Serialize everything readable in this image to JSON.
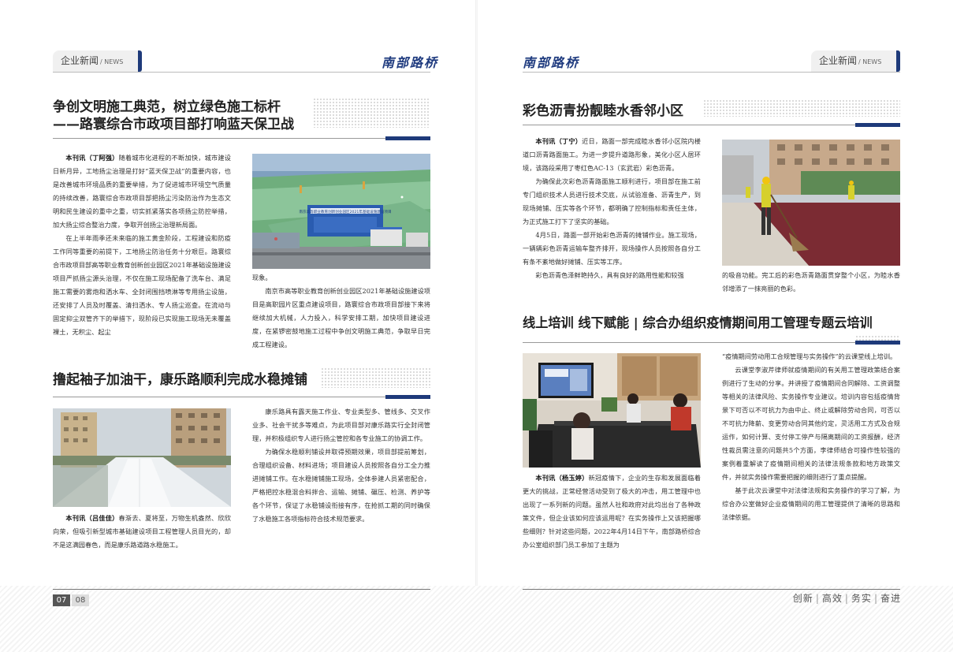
{
  "left_page": {
    "section_tab": "企业新闻",
    "section_tab_en": "/ NEWS",
    "brand": "南部路桥",
    "article1": {
      "title_line1": "争创文明施工典范，树立绿色施工标杆",
      "title_line2": "——路寰综合市政项目部打响蓝天保卫战",
      "byline": "本刊讯（丁阿强）",
      "col1_p1": "随着城市化进程的不断加快，城市建设日新月异，工地扬尘治理是打好“蓝天保卫战”的重要内容，也是改善城市环境品质的重要举措，为了促进城市环境空气质量的持续改善，路寰综合市政项目部把扬尘污染防治作为生态文明和民生建设的重中之重，切实抓紧落实各项扬尘防控举措，加大扬尘综合整治力度，争取开创扬尘治理新局面。",
      "col1_p2": "在上半年雨季还未来临的施工黄金阶段，工程建设和防疫工作同等重要的前提下，工地扬尘防治任务十分艰巨。路寰综合市政项目部高等职业教育创新创业园区2021年基础设施建设项目严抓扬尘源头治理，不仅在施工现场配备了洗车台、满足施工需要的雾炮和洒水车、全封闭围挡喷淋等专用扬尘设施，还安排了人员及时覆盖、清扫洒水、专人扬尘巡查。在流动与固定抑尘双管齐下的举措下，现阶段已实现施工现场无未覆盖裸土，无积尘、起尘",
      "col2_p1": "现象。",
      "col2_p2": "南京市高等职业教育创新创业园区2021年基础设施建设项目是高职园片区重点建设项目，路寰综合市政项目部接下来将继续加大机械，人力投入，科学安排工期，加快项目建设进度，在紧锣密鼓地施工过程中争创文明施工典范，争取早日完成工程建设。",
      "photo_sign": "南京高等职业教育创新创业园区2021年基础设施建设项目"
    },
    "article2": {
      "title": "撸起袖子加油干，康乐路顺利完成水稳摊铺",
      "byline": "本刊讯（吕佳佳）",
      "col1_p1": "春渐去、夏将至，万物生机盎然、欣欣向荣，但吸引新型城市基础建设项目工程管理人员目光的，却不是这满园春色，而是康乐路道路水稳施工。",
      "col2_p1": "康乐路具有露天施工作业、专业类型多、管线多、交叉作业多、社会干扰多等难点，为此项目部对康乐路实行全封闭管理，并积极组织专人进行扬尘管控和各专业施工的协调工作。",
      "col2_p2": "为确保水稳顺利铺设并取得预期效果，项目部提前筹划，合理组织设备、材料进场；项目建设人员按照各自分工全力推进摊铺工作。在水稳摊铺施工现场，全体参建人员紧密配合，严格把控水稳混合料拌合、运输、摊铺、碾压、检测、养护等各个环节，保证了水稳铺设衔接有序，在抢抓工期的同时确保了水稳施工各项指标符合技术规范要求。"
    },
    "page_numbers": [
      "07",
      "08"
    ]
  },
  "right_page": {
    "section_tab": "企业新闻",
    "section_tab_en": "/ NEWS",
    "brand": "南部路桥",
    "article3": {
      "title": "彩色沥青扮靓睦水香邻小区",
      "byline": "本刊讯（丁宁）",
      "col1_p1": "近日，路面一部完成睦水香邻小区院内楼道口沥青路面施工。为进一步提升道路形象，美化小区人居环境，该路段采用了枣红色AC-13（玄武岩）彩色沥青。",
      "col1_p2": "为确保此次彩色沥青路面施工顺利进行，项目部在施工前专门组织技术人员进行技术交底，从试验准备、沥青生产，到现场摊铺、压实等各个环节，都明确了控制指标和责任主体，为正式施工打下了坚实的基础。",
      "col1_p3": "4月5日，路面一部开始彩色沥青的摊铺作业。施工现场，一辆辆彩色沥青运输车整齐排开，现场操作人员按照各自分工有条不紊地做好摊铺、压实等工序。",
      "col1_p4": "彩色沥青色泽鲜艳持久，具有良好的路用性能和较强",
      "col2_p1": "的吸音功能。完工后的彩色沥青路面贯穿整个小区，为睦水香邻增添了一抹亮丽的色彩。"
    },
    "article4": {
      "title": "线上培训 线下赋能 | 综合办组织疫情期间用工管理专题云培训",
      "byline": "本刊讯（杨玉婷）",
      "col1_p1": "新冠疫情下，企业的生存和发展面临着更大的挑战，正常经营活动受到了极大的冲击，用工管理中也出现了一系列新的问题。虽然人社和政府对此均出台了各种政策文件，但企业该如何应该运用呢？在实务操作上又该把握哪些细则？针对这些问题，2022年4月14日下午，南部路桥综合办公室组织部门员工参加了主题为",
      "col2_p1": "“疫情期间劳动用工合规管理与实务操作”的云课堂线上培训。",
      "col2_p2": "云课堂李淑芹律师就疫情期间的有关用工管理政策结合案例进行了生动的分享。并讲授了疫情期间合同解除、工资调整等相关的法律风险、实务操作专业建议。培训内容包括疫情背景下可否以不可抗力为由中止、终止或解除劳动合同，可否以不可抗力降薪、变更劳动合同其他约定，灵活用工方式及合规运作，如何计算、支付停工停产与隔离期间的工资报酬，经济性裁员需注意的问题共5个方面，李律师结合可操作性较强的案例着重解读了疫情期间相关的法律法规条款和地方政策文件，并就实务操作需要把握的细则进行了重点提醒。",
      "col2_p3": "基于此次云课堂中对法律法规和实务操作的学习了解，为综合办公室做好企业疫情期间的用工管理提供了清晰的思路和法律依据。"
    },
    "motto": [
      "创新",
      "高效",
      "务实",
      "奋进"
    ]
  },
  "colors": {
    "brand_blue": "#1e3a7a",
    "title_text": "#222222",
    "body_text": "#333333",
    "tab_bg": "#f0f0f0"
  }
}
